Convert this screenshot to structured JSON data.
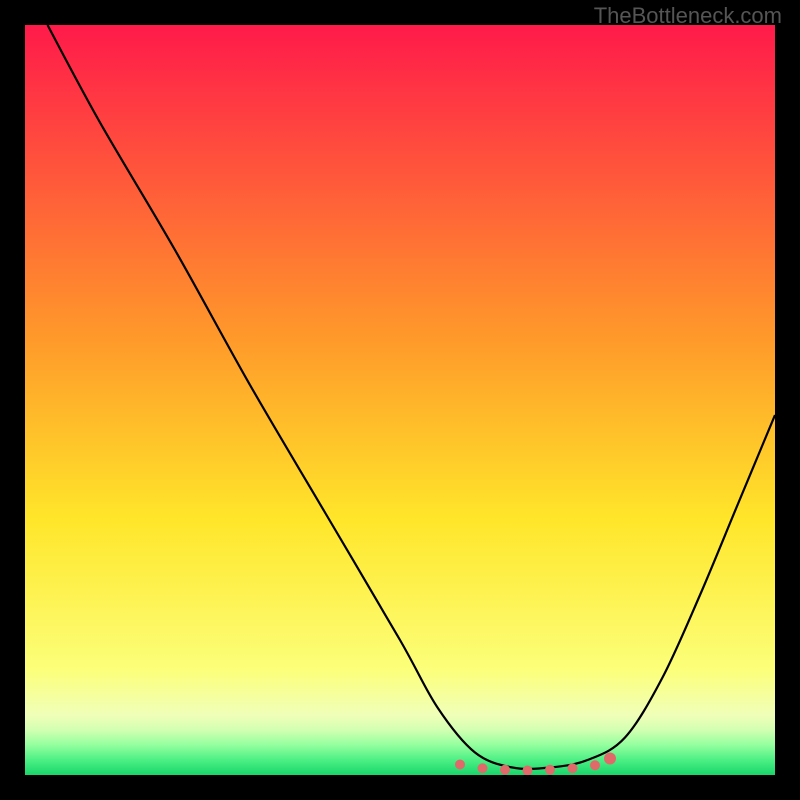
{
  "watermark": "TheBottleneck.com",
  "chart_data": {
    "type": "line",
    "title": "",
    "xlabel": "",
    "ylabel": "",
    "xlim": [
      0,
      100
    ],
    "ylim": [
      0,
      100
    ],
    "gradient_stops": [
      {
        "offset": 0,
        "color": "#ff1a4a"
      },
      {
        "offset": 42,
        "color": "#ff9a2a"
      },
      {
        "offset": 66,
        "color": "#ffe62a"
      },
      {
        "offset": 86,
        "color": "#fcff7a"
      },
      {
        "offset": 92,
        "color": "#f0ffb8"
      },
      {
        "offset": 94,
        "color": "#d2ffb2"
      },
      {
        "offset": 96,
        "color": "#94ff9e"
      },
      {
        "offset": 98,
        "color": "#4cf084"
      },
      {
        "offset": 100,
        "color": "#18d66a"
      }
    ],
    "series": [
      {
        "name": "bottleneck-curve",
        "x": [
          3,
          10,
          20,
          30,
          40,
          50,
          55,
          60,
          65,
          70,
          75,
          80,
          85,
          90,
          95,
          100
        ],
        "y": [
          100,
          87,
          70,
          52,
          35,
          18,
          9,
          3,
          1,
          1,
          2,
          5,
          13,
          24,
          36,
          48
        ]
      }
    ],
    "markers": {
      "name": "highlight-band",
      "color": "#e06a6a",
      "x": [
        58,
        61,
        64,
        67,
        70,
        73,
        76,
        78
      ],
      "y": [
        1.4,
        0.9,
        0.7,
        0.6,
        0.7,
        0.9,
        1.3,
        2.2
      ]
    }
  }
}
